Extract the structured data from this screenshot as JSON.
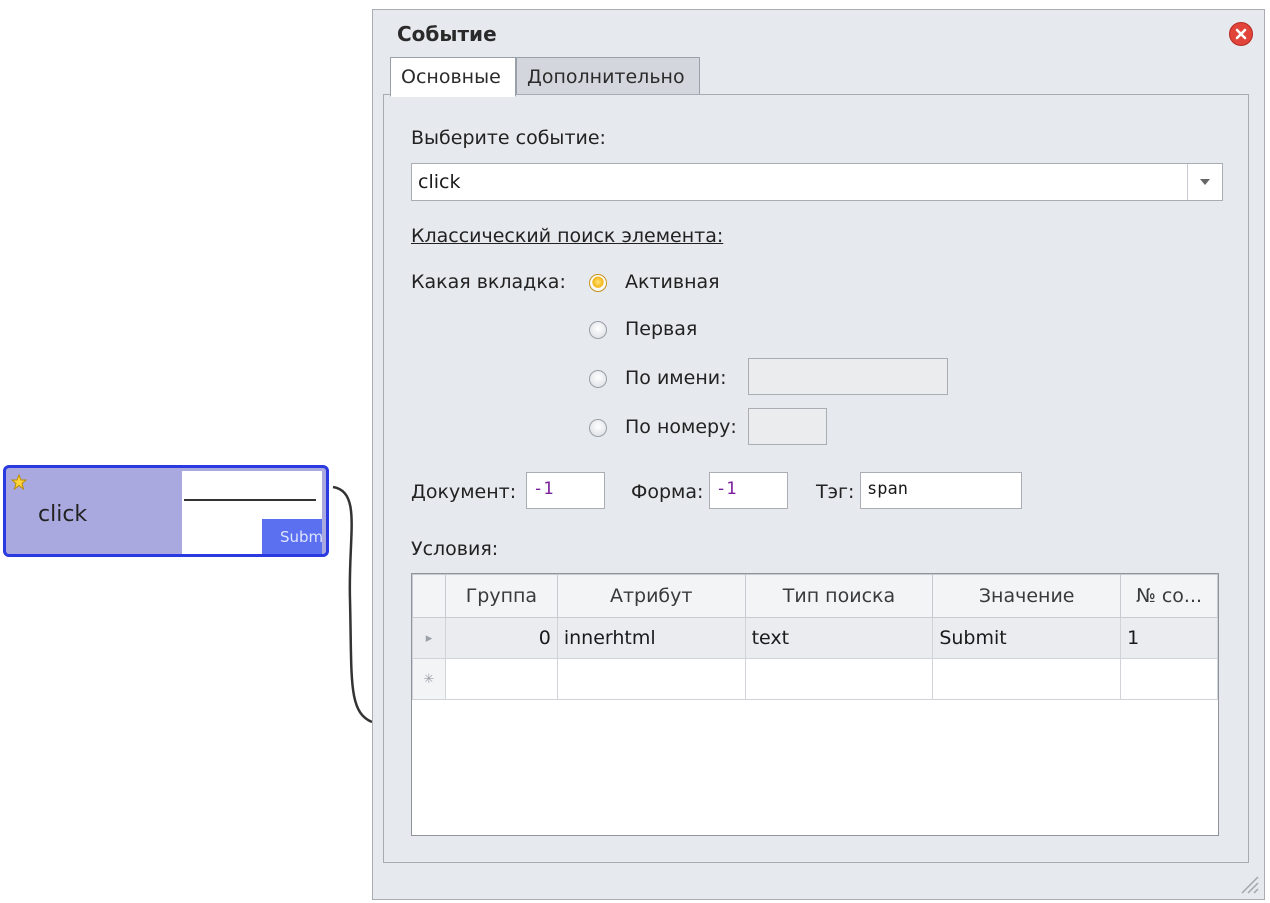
{
  "node": {
    "label": "click",
    "preview_button": "Submit"
  },
  "dialog": {
    "title": "Событие",
    "tabs": [
      "Основные",
      "Дополнительно"
    ],
    "event_label": "Выберите событие:",
    "event_value": "click",
    "classic_search_label": "Классический поиск элемента:",
    "which_tab_label": "Какая вкладка:",
    "tab_options": [
      {
        "label": "Активная",
        "selected": true
      },
      {
        "label": "Первая",
        "selected": false
      },
      {
        "label": "По имени:",
        "selected": false
      },
      {
        "label": "По номеру:",
        "selected": false
      }
    ],
    "document_label": "Документ:",
    "document_value": "-1",
    "form_label": "Форма:",
    "form_value": "-1",
    "tag_label": "Тэг:",
    "tag_value": "span",
    "conditions_label": "Условия:",
    "grid": {
      "columns": [
        "Группа",
        "Атрибут",
        "Тип поиска",
        "Значение",
        "№ со..."
      ],
      "rows": [
        {
          "group": "0",
          "attribute": "innerhtml",
          "search_type": "text",
          "value": "Submit",
          "index": "1"
        }
      ]
    }
  },
  "colors": {
    "node_border": "#2b39e0",
    "node_fill": "#aaa9df",
    "dialog_bg": "#e6e9ed",
    "close_button": "#e0443a",
    "radio_selected": "#f5b417",
    "value_text": "#7a1f9c"
  },
  "icons": [
    "star-icon",
    "close-icon",
    "dropdown-arrow-icon",
    "row-pointer-icon",
    "new-row-icon",
    "resize-grip-icon"
  ]
}
